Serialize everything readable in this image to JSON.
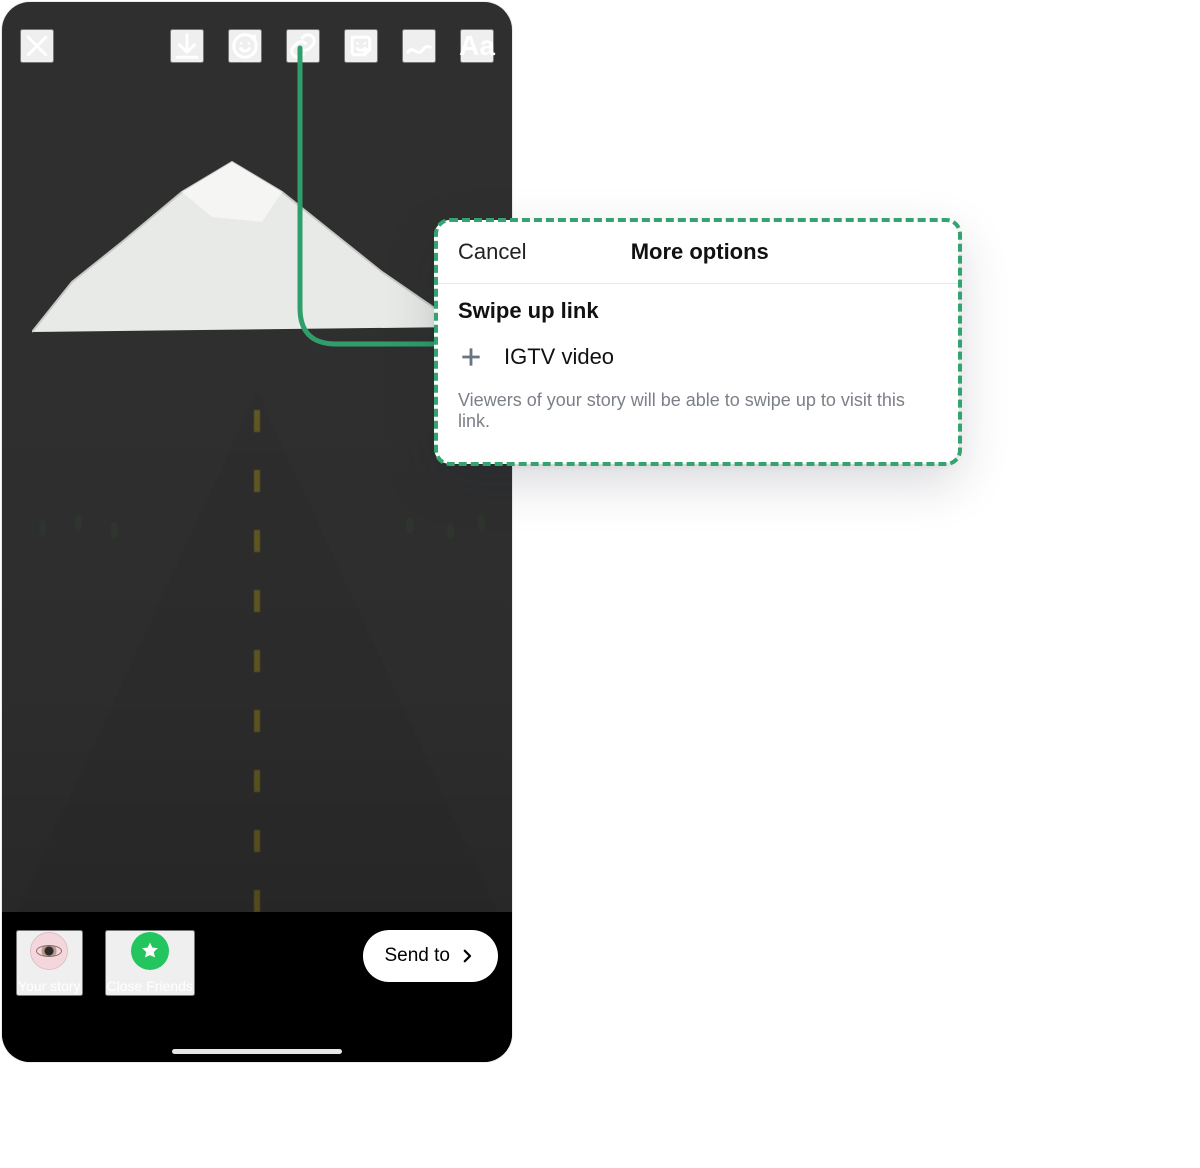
{
  "colors": {
    "accent": "#2f9e6a",
    "link_dash": "#34a36f"
  },
  "story_editor": {
    "toolbar": {
      "close_name": "close-icon",
      "download_name": "download-icon",
      "face_filters_name": "face-filter-icon",
      "link_name": "link-icon",
      "sticker_name": "sticker-icon",
      "draw_name": "draw-icon",
      "text_tool_label": "Aa"
    },
    "destinations": {
      "your_story_label": "Your story",
      "close_friends_label": "Close Friends"
    },
    "send_to_label": "Send to"
  },
  "more_options_sheet": {
    "cancel_label": "Cancel",
    "title": "More options",
    "section_title": "Swipe up link",
    "option_igtv_label": "IGTV video",
    "hint": "Viewers of your story will be able to swipe up to visit this link."
  }
}
